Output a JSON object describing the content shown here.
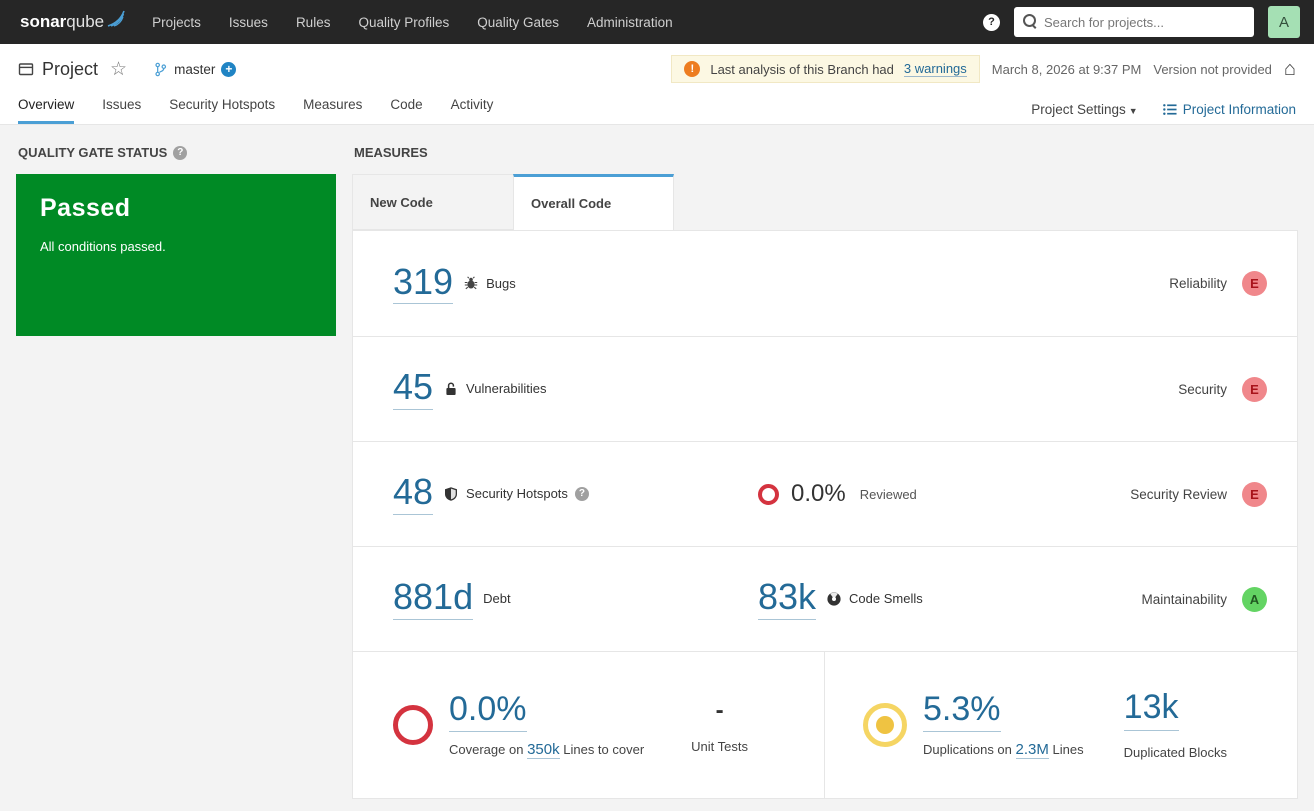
{
  "colors": {
    "nav_bg": "#262626",
    "link_blue": "#236a97",
    "tab_accent": "#4b9fd5",
    "passed_green": "#008a25",
    "warning_bg": "#fcf8e3",
    "warning_icon": "#ed7d20",
    "rating_e_bg": "#f0878b",
    "rating_e_text": "#a8131b",
    "rating_a_bg": "#63d463",
    "rating_a_text": "#215821",
    "ring_red": "#d4333f",
    "ring_yellow": "#f5d563",
    "ring_yellow_dot": "#efc342",
    "avatar_bg": "#a5e0b4"
  },
  "nav": {
    "brand_bold": "sonar",
    "brand_light": "qube",
    "items": [
      "Projects",
      "Issues",
      "Rules",
      "Quality Profiles",
      "Quality Gates",
      "Administration"
    ],
    "help": "?",
    "search_placeholder": "Search for projects...",
    "avatar_letter": "A"
  },
  "header": {
    "project_name": "Project",
    "branch_name": "master",
    "warning_text": "Last analysis of this Branch had",
    "warning_link": "3 warnings",
    "analysis_date": "March 8, 2026 at 9:37 PM",
    "version": "Version not provided",
    "tabs": [
      "Overview",
      "Issues",
      "Security Hotspots",
      "Measures",
      "Code",
      "Activity"
    ],
    "active_tab": "Overview",
    "project_settings": "Project Settings",
    "project_information": "Project Information"
  },
  "quality_gate": {
    "title": "QUALITY GATE STATUS",
    "status": "Passed",
    "description": "All conditions passed."
  },
  "measures": {
    "title": "MEASURES",
    "tab_new": "New Code",
    "tab_overall": "Overall Code",
    "active_tab": "Overall Code",
    "bugs": {
      "value": "319",
      "label": "Bugs",
      "domain": "Reliability",
      "rating": "E"
    },
    "vulnerabilities": {
      "value": "45",
      "label": "Vulnerabilities",
      "domain": "Security",
      "rating": "E"
    },
    "hotspots": {
      "value": "48",
      "label": "Security Hotspots",
      "reviewed_value": "0.0%",
      "reviewed_label": "Reviewed",
      "domain": "Security Review",
      "rating": "E"
    },
    "maintainability": {
      "debt_value": "881d",
      "debt_label": "Debt",
      "smells_value": "83k",
      "smells_label": "Code Smells",
      "domain": "Maintainability",
      "rating": "A"
    },
    "coverage": {
      "value": "0.0%",
      "caption_prefix": "Coverage on",
      "lines_link": "350k",
      "caption_suffix": "Lines to cover",
      "unit_tests_value": "-",
      "unit_tests_label": "Unit Tests"
    },
    "duplications": {
      "value": "5.3%",
      "caption_prefix": "Duplications on",
      "lines_link": "2.3M",
      "caption_suffix": "Lines",
      "blocks_value": "13k",
      "blocks_label": "Duplicated Blocks"
    }
  }
}
